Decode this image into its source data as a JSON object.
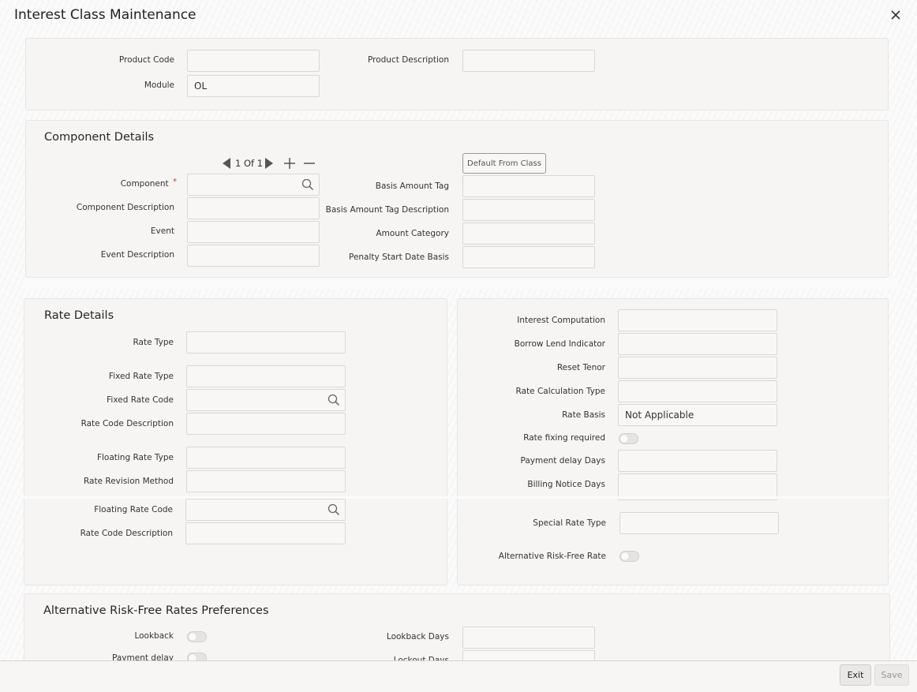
{
  "window": {
    "title": "Interest Class Maintenance",
    "close_glyph": "✕"
  },
  "header": {
    "product_code_label": "Product Code",
    "product_code_value": "",
    "product_description_label": "Product Description",
    "product_description_value": "",
    "module_label": "Module",
    "module_value": "OL"
  },
  "component_details": {
    "title": "Component Details",
    "pager": {
      "text": "1 Of 1"
    },
    "default_from_class_label": "Default From Class",
    "component_label": "Component",
    "required_mark": "*",
    "component_description_label": "Component Description",
    "event_label": "Event",
    "event_description_label": "Event Description",
    "basis_amount_tag_label": "Basis Amount Tag",
    "basis_amount_tag_description_label": "Basis Amount Tag Description",
    "amount_category_label": "Amount Category",
    "penalty_start_date_basis_label": "Penalty Start Date Basis"
  },
  "rate_details": {
    "title": "Rate Details",
    "rate_type_label": "Rate Type",
    "fixed_rate_type_label": "Fixed Rate Type",
    "fixed_rate_code_label": "Fixed Rate Code",
    "rate_code_description_label": "Rate Code Description",
    "floating_rate_type_label": "Floating Rate Type",
    "rate_revision_method_label": "Rate Revision Method",
    "floating_rate_code_label": "Floating Rate Code",
    "floating_rate_code_description_label": "Rate Code Description",
    "interest_computation_label": "Interest Computation",
    "borrow_lend_indicator_label": "Borrow Lend Indicator",
    "reset_tenor_label": "Reset Tenor",
    "rate_calculation_type_label": "Rate Calculation Type",
    "rate_basis_label": "Rate Basis",
    "rate_basis_value": "Not Applicable",
    "rate_fixing_required_label": "Rate fixing required",
    "rate_fixing_required": false,
    "payment_delay_days_label": "Payment delay Days",
    "billing_notice_days_label": "Billing Notice Days",
    "special_rate_type_label": "Special Rate Type",
    "alternative_rfr_label": "Alternative Risk-Free Rate",
    "alternative_rfr": false
  },
  "arfr_preferences": {
    "title": "Alternative Risk-Free Rates Preferences",
    "lookback_label": "Lookback",
    "lookback": false,
    "payment_delay_label": "Payment delay",
    "payment_delay": false,
    "lookback_days_label": "Lookback Days",
    "lockout_days_label": "Lockout Days"
  },
  "footer": {
    "exit_label": "Exit",
    "save_label": "Save"
  },
  "icons": [
    "close-icon",
    "search-icon",
    "prev-arrow-icon",
    "next-arrow-icon",
    "plus-icon",
    "minus-icon"
  ],
  "colors": {
    "required": "#c0392b",
    "panel_bg": "#f6f5f4",
    "field_border": "#dad8d5"
  }
}
